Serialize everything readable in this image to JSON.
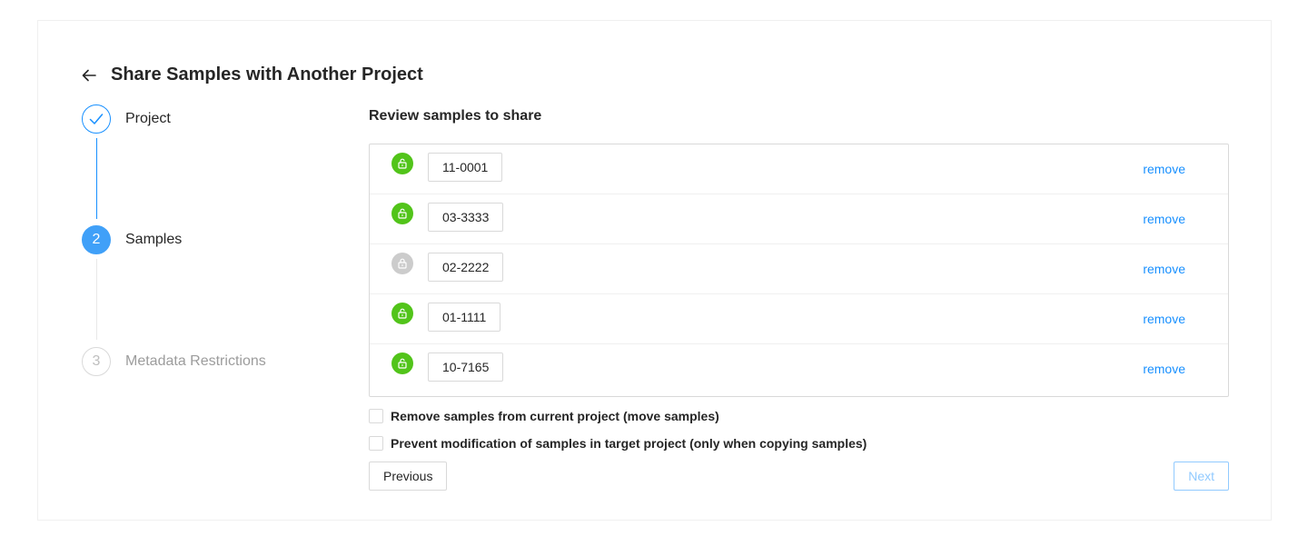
{
  "header": {
    "title": "Share Samples with Another Project",
    "back_icon": "arrow-left-icon"
  },
  "steps": [
    {
      "number": "1",
      "label": "Project",
      "status": "done"
    },
    {
      "number": "2",
      "label": "Samples",
      "status": "active"
    },
    {
      "number": "3",
      "label": "Metadata Restrictions",
      "status": "wait"
    }
  ],
  "main": {
    "section_title": "Review samples to share",
    "samples": [
      {
        "name": "11-0001",
        "locked": false,
        "remove_label": "remove"
      },
      {
        "name": "03-3333",
        "locked": false,
        "remove_label": "remove"
      },
      {
        "name": "02-2222",
        "locked": true,
        "remove_label": "remove"
      },
      {
        "name": "01-1111",
        "locked": false,
        "remove_label": "remove"
      },
      {
        "name": "10-7165",
        "locked": false,
        "remove_label": "remove"
      }
    ],
    "options": [
      {
        "label": "Remove samples from current project (move samples)",
        "checked": false
      },
      {
        "label": "Prevent modification of samples in target project (only when copying samples)",
        "checked": false
      }
    ],
    "buttons": {
      "previous": "Previous",
      "next": "Next"
    }
  },
  "colors": {
    "primary": "#1890ff",
    "unlocked": "#52c41a",
    "locked": "#cccccc",
    "disabled_next": "#91caff"
  }
}
